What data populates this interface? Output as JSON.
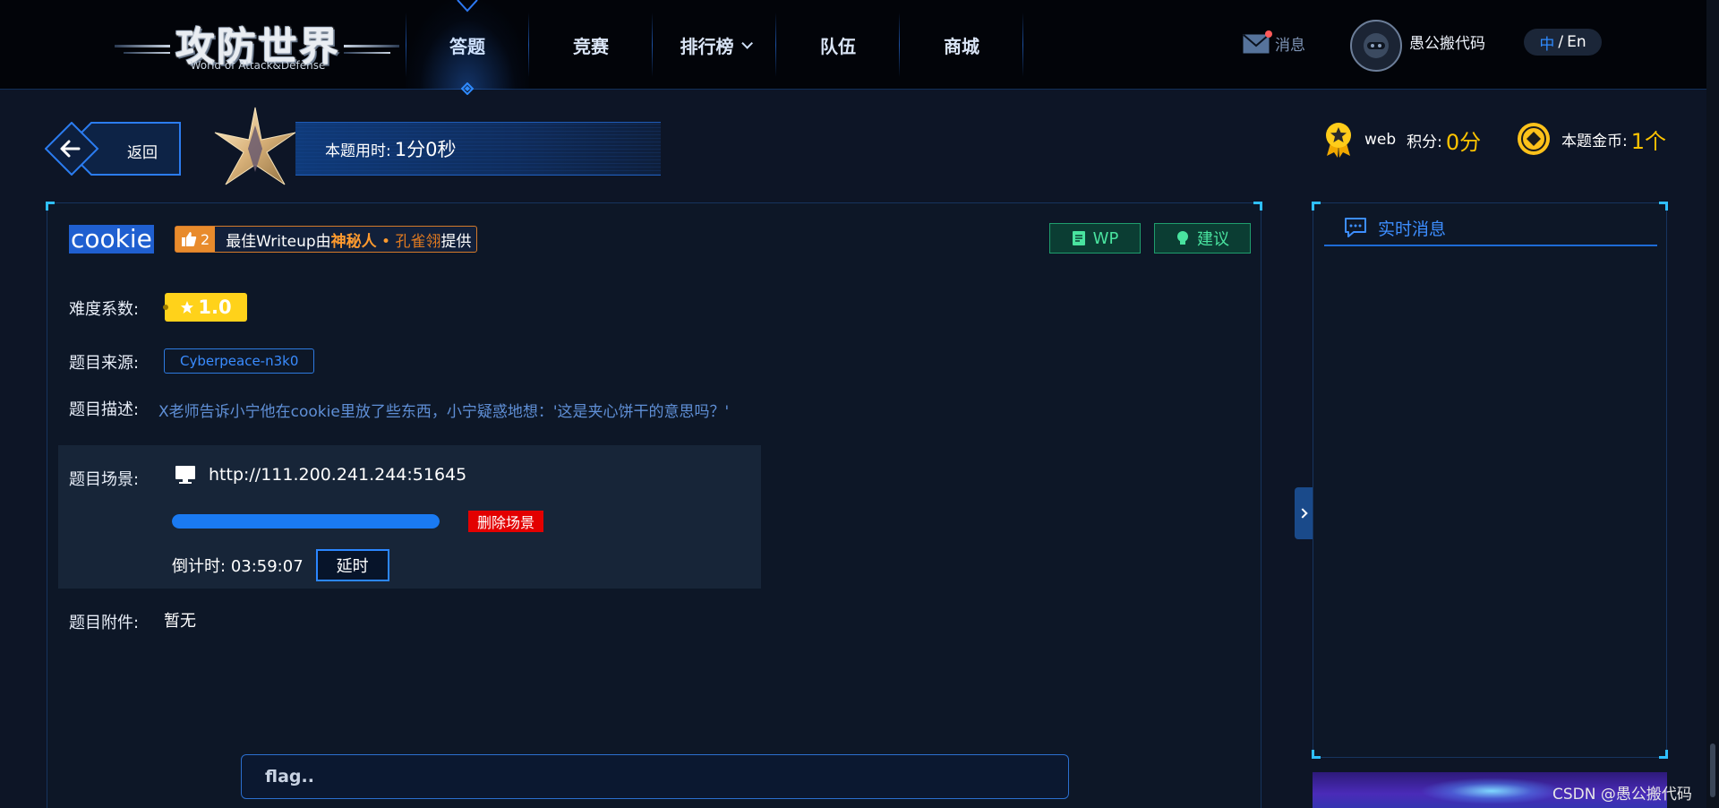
{
  "nav": {
    "logo_cn": "攻防世界",
    "logo_en": "World of Attack&Defense",
    "items": [
      {
        "label": "答题",
        "active": true
      },
      {
        "label": "竞赛",
        "active": false
      },
      {
        "label": "排行榜",
        "active": false,
        "dropdown": true
      },
      {
        "label": "队伍",
        "active": false
      },
      {
        "label": "商城",
        "active": false
      }
    ],
    "messages_label": "消息",
    "username": "愚公搬代码",
    "lang_zh": "中",
    "lang_sep": "/",
    "lang_en": "En"
  },
  "header": {
    "back_label": "返回",
    "time_label": "本题用时:",
    "time_value": "1分0秒",
    "category": "web",
    "score_label": "积分:",
    "score_value": "0分",
    "coins_label": "本题金币:",
    "coins_value": "1个"
  },
  "challenge": {
    "title": "cookie",
    "likes": "2",
    "writeup_prefix": "最佳Writeup由",
    "writeup_author": "神秘人",
    "writeup_dot": "•",
    "writeup_alias": "孔雀翎",
    "writeup_suffix": "提供",
    "wp_label": "WP",
    "advice_label": "建议",
    "difficulty_label": "难度系数:",
    "difficulty_value": "1.0",
    "source_label": "题目来源:",
    "source_value": "Cyberpeace-n3k0",
    "desc_label": "题目描述:",
    "desc_value": "X老师告诉小宁他在cookie里放了些东西，小宁疑惑地想：'这是夹心饼干的意思吗？'",
    "scene_label": "题目场景:",
    "scene_url": "http://111.200.241.244:51645",
    "scene_progress": 1.0,
    "delete_label": "删除场景",
    "countdown_label": "倒计时:",
    "countdown_value": "03:59:07",
    "delay_label": "延时",
    "attachment_label": "题目附件:",
    "attachment_value": "暂无",
    "flag_placeholder": "flag.."
  },
  "side": {
    "title": "实时消息"
  },
  "watermark": "CSDN @愚公搬代码",
  "colors": {
    "accent_blue": "#1a7af2",
    "gold": "#ffc400",
    "green": "#49e39f",
    "danger": "#e30000"
  }
}
